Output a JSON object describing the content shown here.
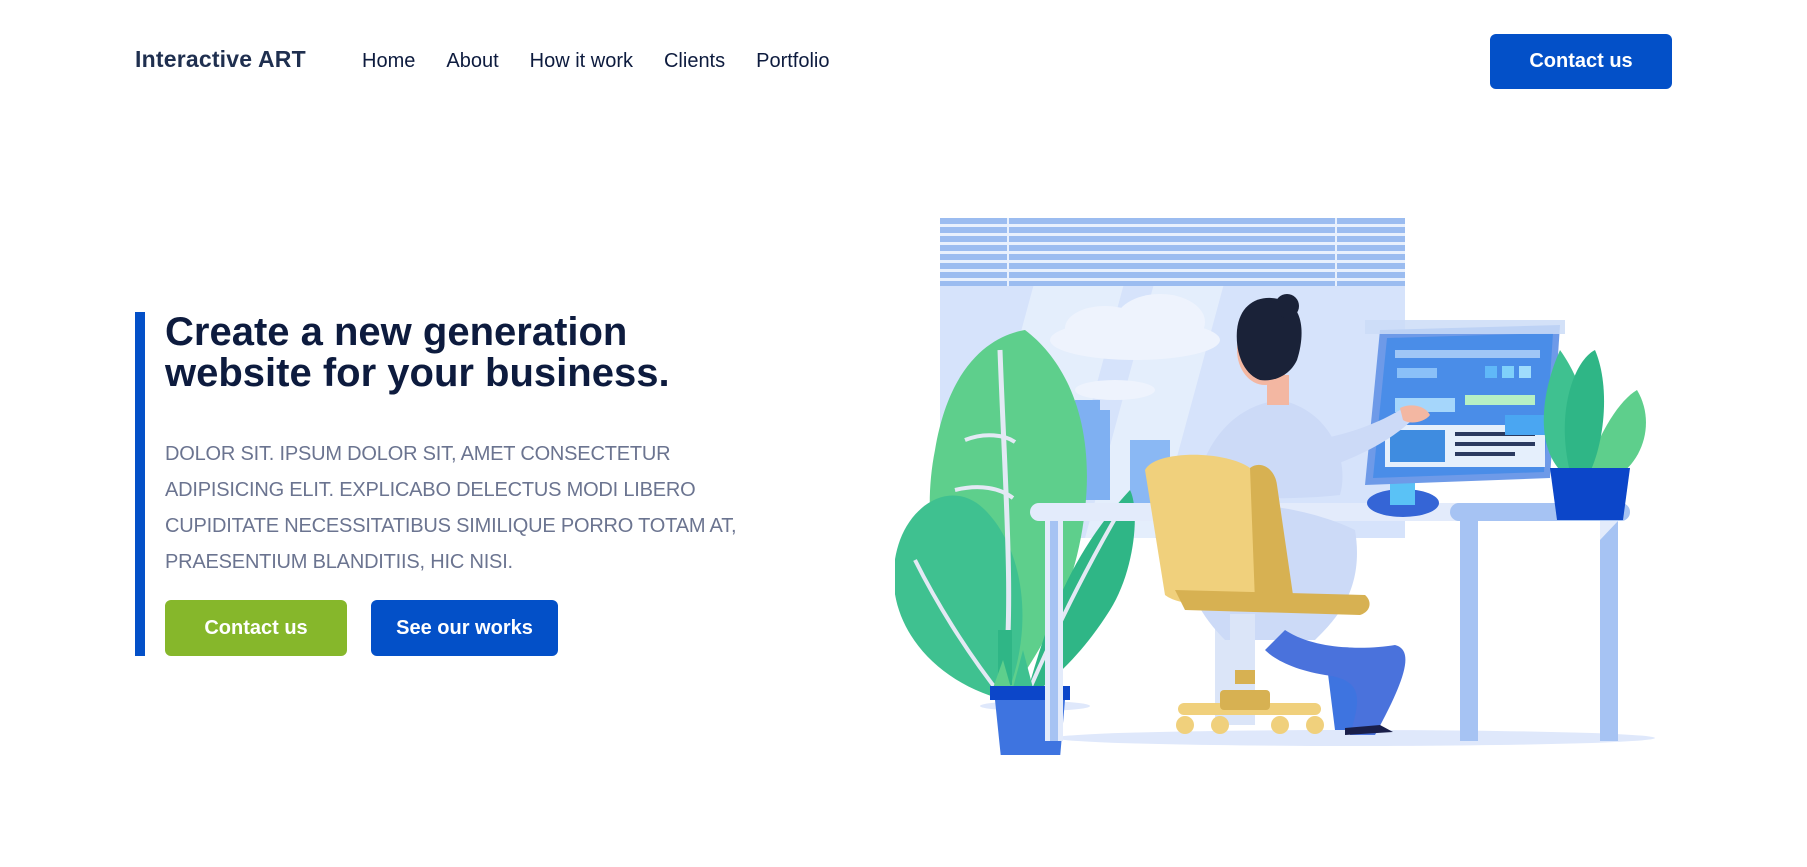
{
  "brand": {
    "logo_text": "Interactive ART"
  },
  "nav": {
    "items": [
      {
        "label": "Home"
      },
      {
        "label": "About"
      },
      {
        "label": "How it work"
      },
      {
        "label": "Clients"
      },
      {
        "label": "Portfolio"
      }
    ],
    "contact_label": "Contact us"
  },
  "hero": {
    "title_line1": "Create a new generation",
    "title_line2": "website for your business.",
    "body": "DOLOR SIT. IPSUM DOLOR SIT, AMET CONSECTETUR ADIPISICING ELIT. EXPLICABO DELECTUS MODI LIBERO CUPIDITATE NECESSITATIBUS SIMILIQUE PORRO TOTAM AT, PRAESENTIUM BLANDITIIS, HIC NISI.",
    "primary_button": "Contact us",
    "secondary_button": "See our works"
  },
  "colors": {
    "primary_blue": "#0350c8",
    "accent_green": "#86b72b",
    "heading": "#0d1b3e",
    "body_text": "#6b7490"
  }
}
